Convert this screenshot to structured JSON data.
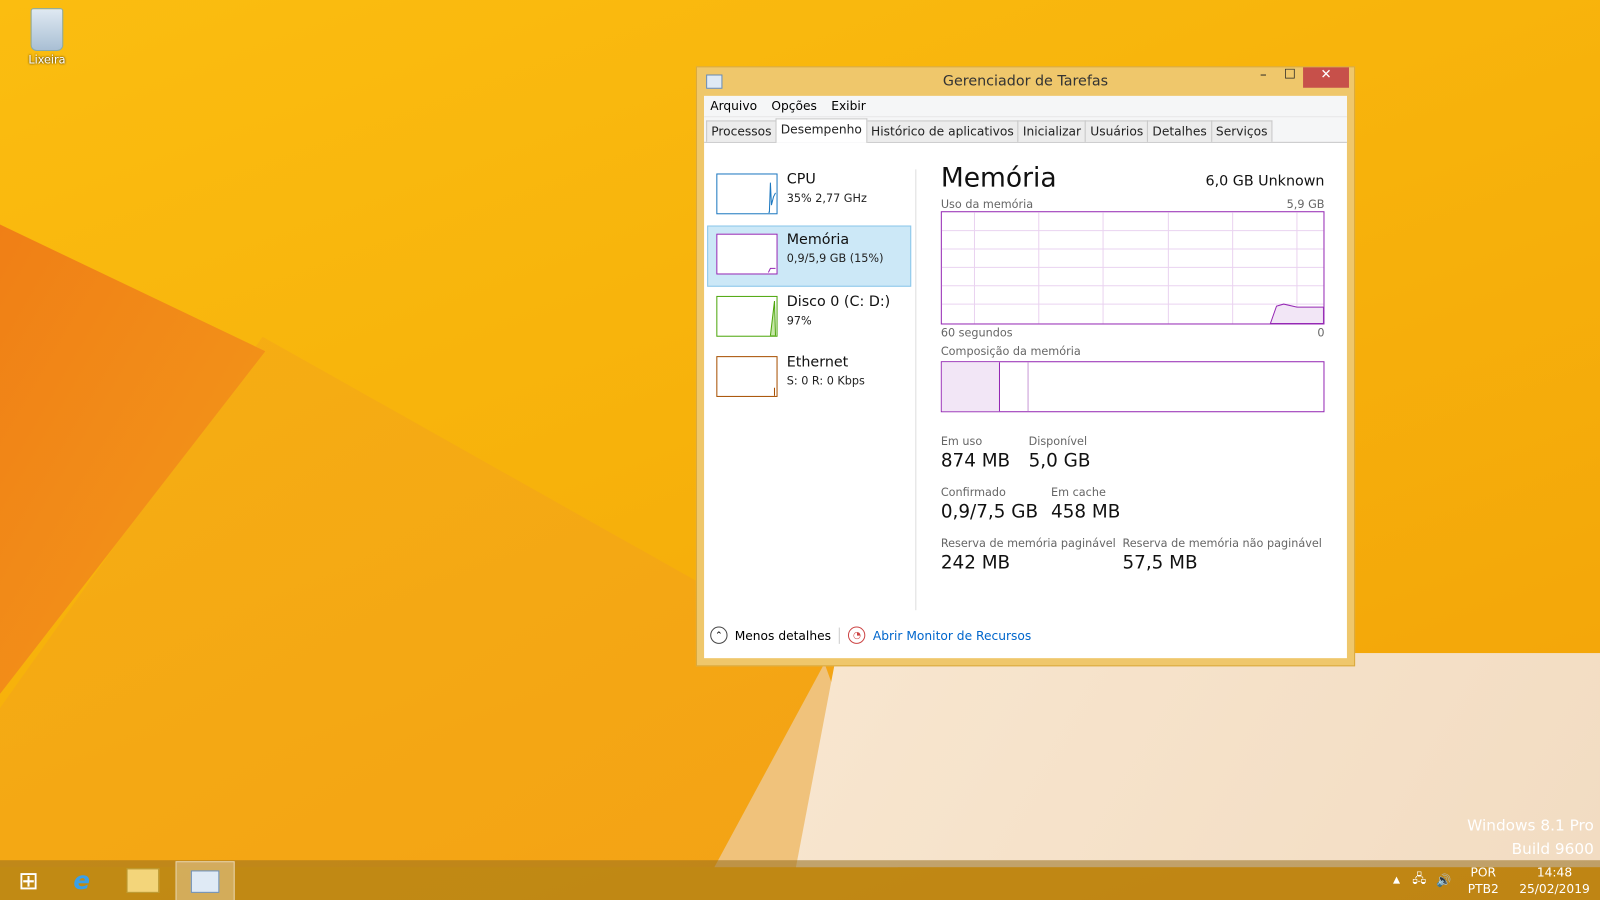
{
  "desktop": {
    "recycle_bin_label": "Lixeira",
    "watermark_line1": "Windows 8.1 Pro",
    "watermark_line2": "Build 9600"
  },
  "window": {
    "title": "Gerenciador de Tarefas",
    "minimize": "–",
    "maximize": "☐",
    "close": "✕"
  },
  "menu": [
    "Arquivo",
    "Opções",
    "Exibir"
  ],
  "tabs": [
    {
      "label": "Processos"
    },
    {
      "label": "Desempenho",
      "selected": true
    },
    {
      "label": "Histórico de aplicativos"
    },
    {
      "label": "Inicializar"
    },
    {
      "label": "Usuários"
    },
    {
      "label": "Detalhes"
    },
    {
      "label": "Serviços"
    }
  ],
  "resources": [
    {
      "name": "CPU",
      "detail": "35% 2,77 GHz",
      "color": "#1c78c0"
    },
    {
      "name": "Memória",
      "detail": "0,9/5,9 GB (15%)",
      "color": "#9528b4",
      "selected": true
    },
    {
      "name": "Disco 0 (C: D:)",
      "detail": "97%",
      "color": "#4da60c"
    },
    {
      "name": "Ethernet",
      "detail": "S: 0 R: 0 Kbps",
      "color": "#a74f01"
    }
  ],
  "memory": {
    "title": "Memória",
    "capacity": "6,0 GB Unknown",
    "usage_label": "Uso da memória",
    "usage_max": "5,9 GB",
    "axis_left": "60 segundos",
    "axis_right": "0",
    "composition_label": "Composição da memória",
    "stats": {
      "in_use_label": "Em uso",
      "in_use": "874 MB",
      "available_label": "Disponível",
      "available": "5,0 GB",
      "committed_label": "Confirmado",
      "committed": "0,9/7,5 GB",
      "cached_label": "Em cache",
      "cached": "458 MB",
      "paged_label": "Reserva de memória paginável",
      "paged": "242 MB",
      "nonpaged_label": "Reserva de memória não paginável",
      "nonpaged": "57,5 MB"
    }
  },
  "footer": {
    "fewer_details": "Menos detalhes",
    "open_monitor": "Abrir Monitor de Recursos"
  },
  "tray": {
    "lang1": "POR",
    "lang2": "PTB2",
    "time": "14:48",
    "date": "25/02/2019"
  }
}
